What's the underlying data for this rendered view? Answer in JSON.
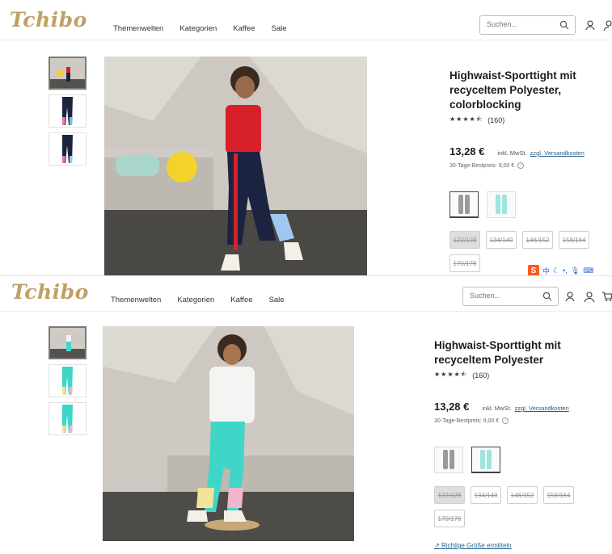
{
  "brand": {
    "logo_text": "Tchibo",
    "color": "#c1a064"
  },
  "header": {
    "nav": [
      "Themenwelten",
      "Kategorien",
      "Kaffee",
      "Sale"
    ],
    "search": {
      "placeholder": "Suchen..."
    }
  },
  "top": {
    "title": "Highwaist-Sporttight mit recyceltem Polyester, colorblocking",
    "rating_count": "(160)",
    "stars": "★★★★⯪",
    "price": "13,28 €",
    "tax_note": "inkl. MwSt.",
    "shipping_link": "zzgl. Versandkosten",
    "best_price": "30-Tage-Bestpreis: 9,00 €",
    "sizes": [
      "122/128",
      "134/140",
      "146/152",
      "158/164",
      "170/176"
    ]
  },
  "bottom": {
    "title": "Highwaist-Sporttight mit recyceltem Polyester",
    "rating_count": "(160)",
    "stars": "★★★★⯪",
    "price": "13,28 €",
    "tax_note": "inkl. MwSt.",
    "shipping_link": "zzgl. Versandkosten",
    "best_price": "30-Tage-Bestpreis: 9,00 €",
    "sizes": [
      "122/128",
      "134/140",
      "146/152",
      "158/164",
      "170/176"
    ],
    "size_guide_link": "Richtige Größe ermitteln"
  },
  "ime_bar": {
    "logo": "S",
    "label": "中"
  },
  "colors": {
    "accent_link": "#1f5c8a",
    "navy": "#1c2340",
    "turquoise": "#3fd6c8",
    "red": "#d8202a"
  }
}
